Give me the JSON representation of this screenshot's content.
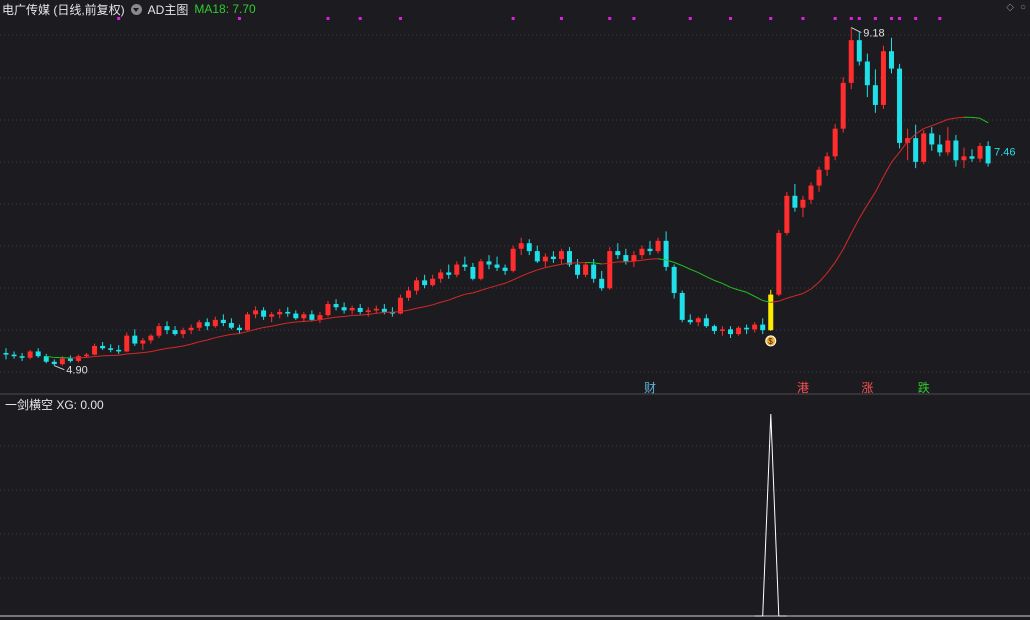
{
  "header": {
    "title": "电广传媒 (日线,前复权)",
    "indicator": "AD主图",
    "ma_label": "MA18: 7.70"
  },
  "sub_header": {
    "label": "一剑横空  XG: 0.00"
  },
  "annotations": {
    "high_label": "9.18",
    "low_label": "4.90",
    "last_label": "7.46"
  },
  "markers": [
    {
      "text": "财",
      "color": "#5fb4d8"
    },
    {
      "text": "港",
      "color": "#ff5050"
    },
    {
      "text": "涨",
      "color": "#ff5050"
    },
    {
      "text": "跌",
      "color": "#2ecc2e"
    }
  ],
  "colors": {
    "up": "#ff2d2d",
    "down": "#1fe0e8",
    "ma_up": "#d62828",
    "ma_down": "#20c020",
    "signal": "#ffeb00",
    "dots": "#e020e0",
    "xg": "#ffffff"
  },
  "chart_data": {
    "type": "candlestick",
    "ma_period": 18,
    "ma_last": 7.7,
    "high": 9.18,
    "low": 4.9,
    "last_close": 7.46,
    "candles": [
      [
        5.06,
        5.12,
        4.98,
        5.04
      ],
      [
        5.04,
        5.08,
        4.99,
        5.02
      ],
      [
        5.02,
        5.06,
        4.96,
        5.0
      ],
      [
        5.0,
        5.1,
        4.98,
        5.08
      ],
      [
        5.08,
        5.12,
        5.0,
        5.02
      ],
      [
        5.02,
        5.05,
        4.93,
        4.95
      ],
      [
        4.95,
        4.98,
        4.9,
        4.92
      ],
      [
        4.92,
        5.02,
        4.9,
        4.99
      ],
      [
        4.99,
        5.03,
        4.94,
        4.96
      ],
      [
        4.96,
        5.04,
        4.94,
        5.02
      ],
      [
        5.02,
        5.06,
        5.0,
        5.04
      ],
      [
        5.04,
        5.18,
        5.03,
        5.15
      ],
      [
        5.15,
        5.2,
        5.1,
        5.12
      ],
      [
        5.12,
        5.17,
        5.07,
        5.1
      ],
      [
        5.1,
        5.16,
        5.05,
        5.08
      ],
      [
        5.08,
        5.32,
        5.07,
        5.28
      ],
      [
        5.28,
        5.36,
        5.15,
        5.18
      ],
      [
        5.18,
        5.25,
        5.1,
        5.22
      ],
      [
        5.22,
        5.3,
        5.18,
        5.28
      ],
      [
        5.28,
        5.44,
        5.25,
        5.4
      ],
      [
        5.4,
        5.46,
        5.3,
        5.35
      ],
      [
        5.35,
        5.4,
        5.28,
        5.3
      ],
      [
        5.3,
        5.38,
        5.25,
        5.35
      ],
      [
        5.35,
        5.42,
        5.3,
        5.38
      ],
      [
        5.38,
        5.48,
        5.34,
        5.45
      ],
      [
        5.45,
        5.5,
        5.35,
        5.4
      ],
      [
        5.4,
        5.52,
        5.38,
        5.48
      ],
      [
        5.48,
        5.55,
        5.4,
        5.44
      ],
      [
        5.44,
        5.5,
        5.36,
        5.38
      ],
      [
        5.38,
        5.42,
        5.3,
        5.35
      ],
      [
        5.35,
        5.58,
        5.34,
        5.55
      ],
      [
        5.55,
        5.65,
        5.5,
        5.6
      ],
      [
        5.6,
        5.64,
        5.48,
        5.52
      ],
      [
        5.52,
        5.58,
        5.45,
        5.55
      ],
      [
        5.55,
        5.62,
        5.5,
        5.58
      ],
      [
        5.58,
        5.64,
        5.52,
        5.56
      ],
      [
        5.56,
        5.6,
        5.48,
        5.5
      ],
      [
        5.5,
        5.58,
        5.45,
        5.55
      ],
      [
        5.55,
        5.6,
        5.46,
        5.48
      ],
      [
        5.48,
        5.58,
        5.44,
        5.54
      ],
      [
        5.54,
        5.72,
        5.52,
        5.68
      ],
      [
        5.68,
        5.74,
        5.6,
        5.64
      ],
      [
        5.64,
        5.7,
        5.56,
        5.6
      ],
      [
        5.6,
        5.66,
        5.55,
        5.63
      ],
      [
        5.63,
        5.68,
        5.55,
        5.58
      ],
      [
        5.58,
        5.64,
        5.52,
        5.6
      ],
      [
        5.6,
        5.66,
        5.56,
        5.62
      ],
      [
        5.62,
        5.68,
        5.55,
        5.58
      ],
      [
        5.58,
        5.64,
        5.52,
        5.56
      ],
      [
        5.56,
        5.8,
        5.55,
        5.76
      ],
      [
        5.76,
        5.9,
        5.72,
        5.85
      ],
      [
        5.85,
        6.02,
        5.8,
        5.98
      ],
      [
        5.98,
        6.05,
        5.88,
        5.92
      ],
      [
        5.92,
        6.05,
        5.9,
        6.0
      ],
      [
        6.0,
        6.12,
        5.95,
        6.08
      ],
      [
        6.08,
        6.18,
        6.0,
        6.05
      ],
      [
        6.05,
        6.22,
        6.02,
        6.18
      ],
      [
        6.18,
        6.28,
        6.1,
        6.15
      ],
      [
        6.15,
        6.2,
        5.98,
        6.0
      ],
      [
        6.0,
        6.25,
        5.98,
        6.22
      ],
      [
        6.22,
        6.3,
        6.12,
        6.18
      ],
      [
        6.18,
        6.28,
        6.1,
        6.14
      ],
      [
        6.14,
        6.18,
        6.05,
        6.1
      ],
      [
        6.1,
        6.42,
        6.08,
        6.38
      ],
      [
        6.38,
        6.52,
        6.3,
        6.45
      ],
      [
        6.45,
        6.5,
        6.3,
        6.35
      ],
      [
        6.35,
        6.42,
        6.2,
        6.22
      ],
      [
        6.22,
        6.32,
        6.15,
        6.28
      ],
      [
        6.28,
        6.35,
        6.2,
        6.25
      ],
      [
        6.25,
        6.38,
        6.18,
        6.35
      ],
      [
        6.35,
        6.4,
        6.15,
        6.18
      ],
      [
        6.18,
        6.25,
        6.0,
        6.05
      ],
      [
        6.05,
        6.2,
        6.02,
        6.18
      ],
      [
        6.18,
        6.25,
        5.95,
        6.0
      ],
      [
        6.0,
        6.1,
        5.85,
        5.88
      ],
      [
        5.88,
        6.4,
        5.86,
        6.35
      ],
      [
        6.35,
        6.45,
        6.25,
        6.3
      ],
      [
        6.3,
        6.38,
        6.18,
        6.22
      ],
      [
        6.22,
        6.35,
        6.15,
        6.3
      ],
      [
        6.3,
        6.42,
        6.25,
        6.38
      ],
      [
        6.38,
        6.48,
        6.3,
        6.35
      ],
      [
        6.35,
        6.52,
        6.32,
        6.48
      ],
      [
        6.48,
        6.6,
        6.1,
        6.15
      ],
      [
        6.15,
        6.18,
        5.75,
        5.82
      ],
      [
        5.82,
        5.85,
        5.45,
        5.48
      ],
      [
        5.48,
        5.55,
        5.42,
        5.45
      ],
      [
        5.45,
        5.52,
        5.4,
        5.5
      ],
      [
        5.5,
        5.55,
        5.38,
        5.4
      ],
      [
        5.4,
        5.42,
        5.3,
        5.34
      ],
      [
        5.34,
        5.4,
        5.28,
        5.36
      ],
      [
        5.36,
        5.4,
        5.25,
        5.3
      ],
      [
        5.3,
        5.4,
        5.28,
        5.38
      ],
      [
        5.38,
        5.42,
        5.3,
        5.36
      ],
      [
        5.36,
        5.45,
        5.32,
        5.42
      ],
      [
        5.42,
        5.5,
        5.3,
        5.35
      ],
      [
        5.35,
        5.86,
        5.34,
        5.8
      ],
      [
        5.8,
        6.62,
        5.78,
        6.58
      ],
      [
        6.58,
        7.1,
        6.55,
        7.05
      ],
      [
        7.05,
        7.2,
        6.85,
        6.9
      ],
      [
        6.9,
        7.05,
        6.78,
        7.0
      ],
      [
        7.0,
        7.22,
        6.95,
        7.18
      ],
      [
        7.18,
        7.42,
        7.1,
        7.38
      ],
      [
        7.38,
        7.6,
        7.3,
        7.55
      ],
      [
        7.55,
        7.96,
        7.5,
        7.9
      ],
      [
        7.9,
        8.55,
        7.85,
        8.48
      ],
      [
        8.48,
        9.18,
        8.4,
        9.02
      ],
      [
        9.02,
        9.12,
        8.7,
        8.75
      ],
      [
        8.75,
        8.85,
        8.3,
        8.45
      ],
      [
        8.45,
        8.65,
        8.1,
        8.2
      ],
      [
        8.2,
        8.95,
        8.15,
        8.88
      ],
      [
        8.88,
        9.05,
        8.6,
        8.66
      ],
      [
        8.66,
        8.72,
        7.65,
        7.72
      ],
      [
        7.72,
        7.9,
        7.5,
        7.78
      ],
      [
        7.78,
        7.95,
        7.4,
        7.48
      ],
      [
        7.48,
        7.88,
        7.45,
        7.84
      ],
      [
        7.84,
        7.92,
        7.62,
        7.7
      ],
      [
        7.7,
        7.82,
        7.55,
        7.6
      ],
      [
        7.6,
        7.92,
        7.56,
        7.75
      ],
      [
        7.75,
        7.82,
        7.42,
        7.5
      ],
      [
        7.5,
        7.66,
        7.4,
        7.55
      ],
      [
        7.55,
        7.64,
        7.48,
        7.52
      ],
      [
        7.52,
        7.72,
        7.48,
        7.68
      ],
      [
        7.68,
        7.74,
        7.42,
        7.46
      ]
    ],
    "signal_index": 95,
    "xg_values": [
      0,
      0,
      1,
      0,
      0
    ],
    "xg_start_index": 93,
    "marker_indices": [
      80,
      99,
      107,
      114
    ],
    "dot_indices": [
      14,
      29,
      40,
      44,
      49,
      63,
      69,
      75,
      78,
      85,
      90,
      95,
      99,
      103,
      105,
      106,
      108,
      110,
      111,
      113,
      116
    ]
  }
}
